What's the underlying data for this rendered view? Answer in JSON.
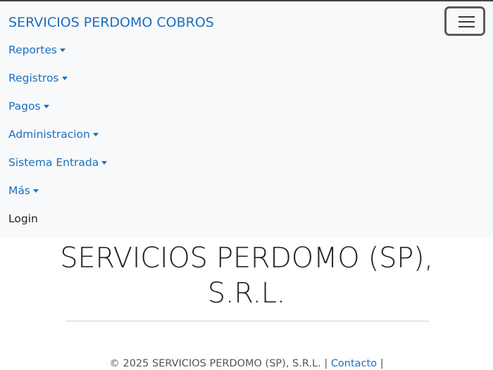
{
  "navbar": {
    "brand": "SERVICIOS PERDOMO COBROS",
    "toggler_icon": "hamburger-menu-icon",
    "items": [
      {
        "label": "Reportes",
        "dropdown": true
      },
      {
        "label": "Registros",
        "dropdown": true
      },
      {
        "label": "Pagos",
        "dropdown": true
      },
      {
        "label": "Administracion",
        "dropdown": true
      },
      {
        "label": "Sistema Entrada",
        "dropdown": true
      },
      {
        "label": "Más",
        "dropdown": true
      },
      {
        "label": "Login",
        "dropdown": false
      }
    ]
  },
  "main": {
    "heading_line1": "SERVICIOS PERDOMO (SP),",
    "heading_line2": "S.R.L."
  },
  "footer": {
    "copyright": "© 2025 SERVICIOS PERDOMO (SP), S.R.L. |",
    "contact_link": "Contacto",
    "trailing_separator": "|"
  },
  "colors": {
    "link": "#1a6fc0",
    "navbar_bg": "#f8f9fa",
    "text": "#212529"
  }
}
